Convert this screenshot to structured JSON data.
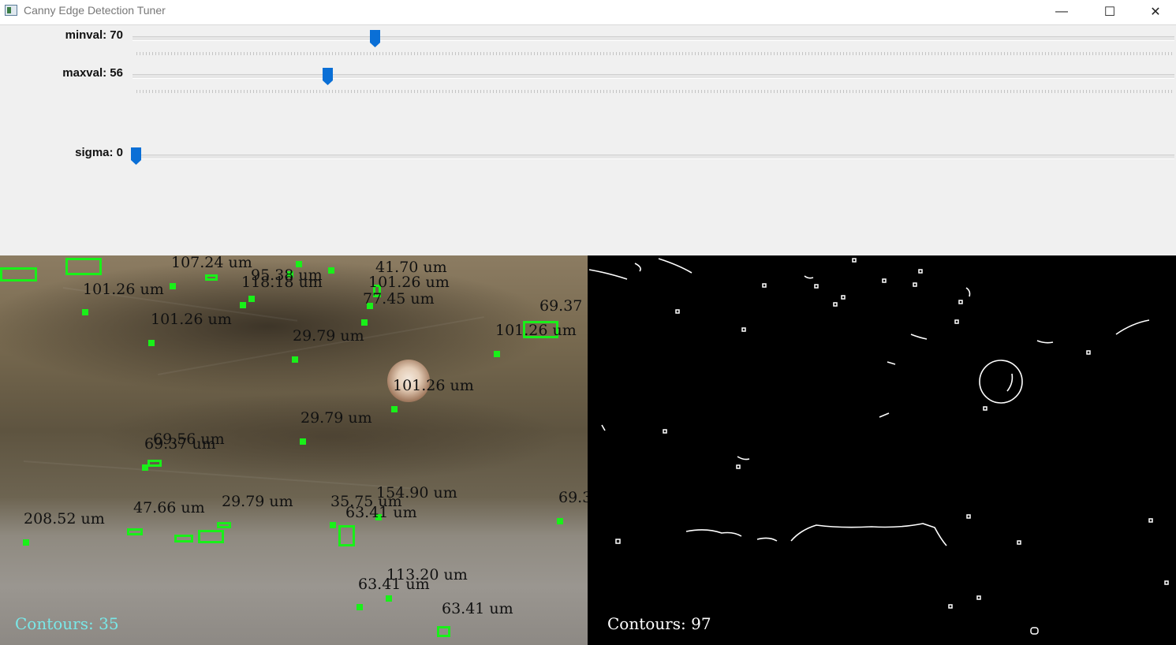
{
  "window": {
    "title": "Canny Edge Detection Tuner",
    "minimize_glyph": "—",
    "maximize_glyph": "☐",
    "close_glyph": "✕"
  },
  "trackbars": [
    {
      "label": "minval: 70",
      "value": 70
    },
    {
      "label": "maxval: 56",
      "value": 56
    },
    {
      "label": "sigma: 0",
      "value": 0
    }
  ],
  "left_view": {
    "contours_text": "Contours: 35",
    "measurements": [
      "107.24 um",
      "95.38 um",
      "41.70 um",
      "101.26 um",
      "118.18 um",
      "77.45 um",
      "101.26 um",
      "101.26 um",
      "69.37",
      "101.26 um",
      "29.79 um",
      "101.26 um",
      "29.79 um",
      "69.56 um",
      "69.37 um",
      "47.66 um",
      "29.79 um",
      "35.75 um",
      "154.90 um",
      "208.52 um",
      "63.41 um",
      "69.3",
      "113.20 um",
      "63.41 um",
      "63.41 um"
    ]
  },
  "right_view": {
    "contours_text": "Contours: 97"
  },
  "colors": {
    "thumb": "#0a6fd6",
    "contour_green": "#19f019",
    "left_count": "#79e8e8",
    "right_count": "#ffffff"
  }
}
